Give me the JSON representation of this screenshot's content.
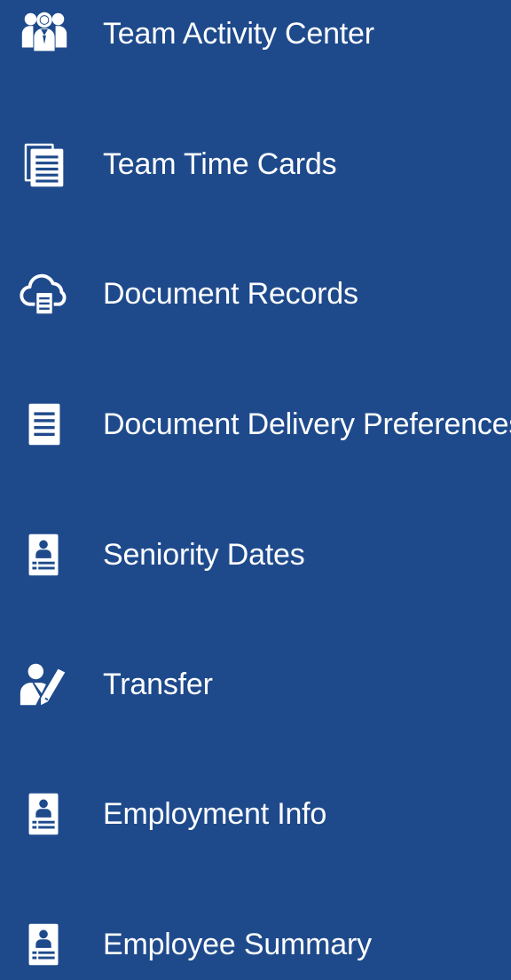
{
  "menu": {
    "items": [
      {
        "label": "Team Activity Center",
        "icon": "team-icon"
      },
      {
        "label": "Team Time Cards",
        "icon": "time-cards-icon"
      },
      {
        "label": "Document Records",
        "icon": "cloud-document-icon"
      },
      {
        "label": "Document Delivery Preferences",
        "icon": "document-icon"
      },
      {
        "label": "Seniority Dates",
        "icon": "badge-icon"
      },
      {
        "label": "Transfer",
        "icon": "person-edit-icon"
      },
      {
        "label": "Employment Info",
        "icon": "badge-icon"
      },
      {
        "label": "Employee Summary",
        "icon": "badge-icon"
      }
    ]
  },
  "colors": {
    "background": "#1e4a8c",
    "text": "#ffffff"
  }
}
